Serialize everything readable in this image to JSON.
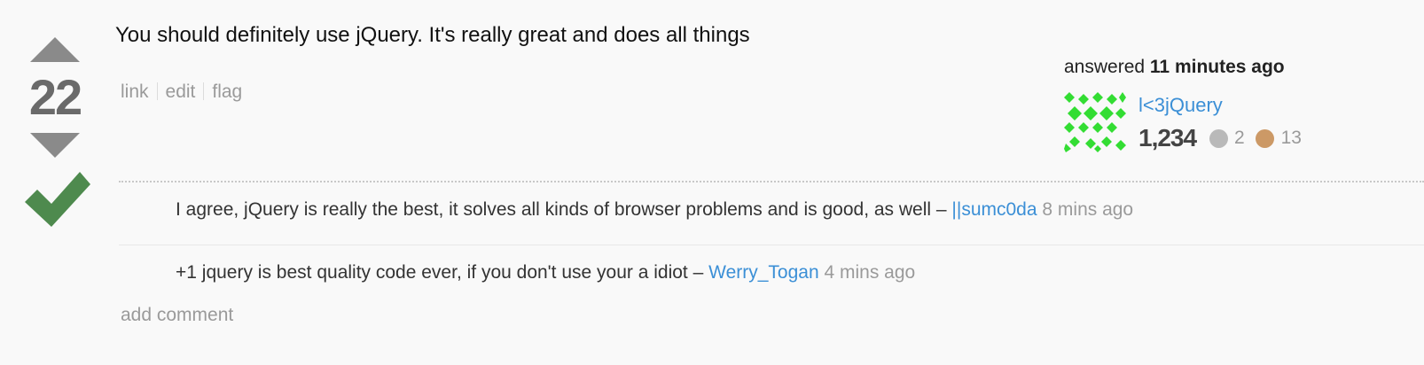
{
  "vote": {
    "score": "22",
    "accepted_color": "#4e8a4e",
    "arrow_color": "#8a8a8a"
  },
  "post": {
    "body": "You should definitely use jQuery. It's really great and does all things",
    "menu": {
      "link": "link",
      "edit": "edit",
      "flag": "flag"
    }
  },
  "user_card": {
    "answered_prefix": "answered",
    "answered_time": "11 minutes ago",
    "user_name": "l<3jQuery",
    "reputation": "1,234",
    "silver_badges": "2",
    "bronze_badges": "13",
    "gravatar_color": "#33dd33"
  },
  "comments": [
    {
      "text": "I agree, jQuery is really the best, it solves all kinds of browser problems and is good, as well –",
      "user": "||sumc0da",
      "date": "8 mins ago"
    },
    {
      "text": "+1 jquery is best quality code ever, if you don't use your a idiot –",
      "user": "Werry_Togan",
      "date": "4 mins ago"
    }
  ],
  "add_comment_label": "add comment",
  "colors": {
    "link": "#3b8fd6",
    "muted": "#9a9a9a",
    "silver": "#b9b9b9",
    "bronze": "#cc9966"
  }
}
